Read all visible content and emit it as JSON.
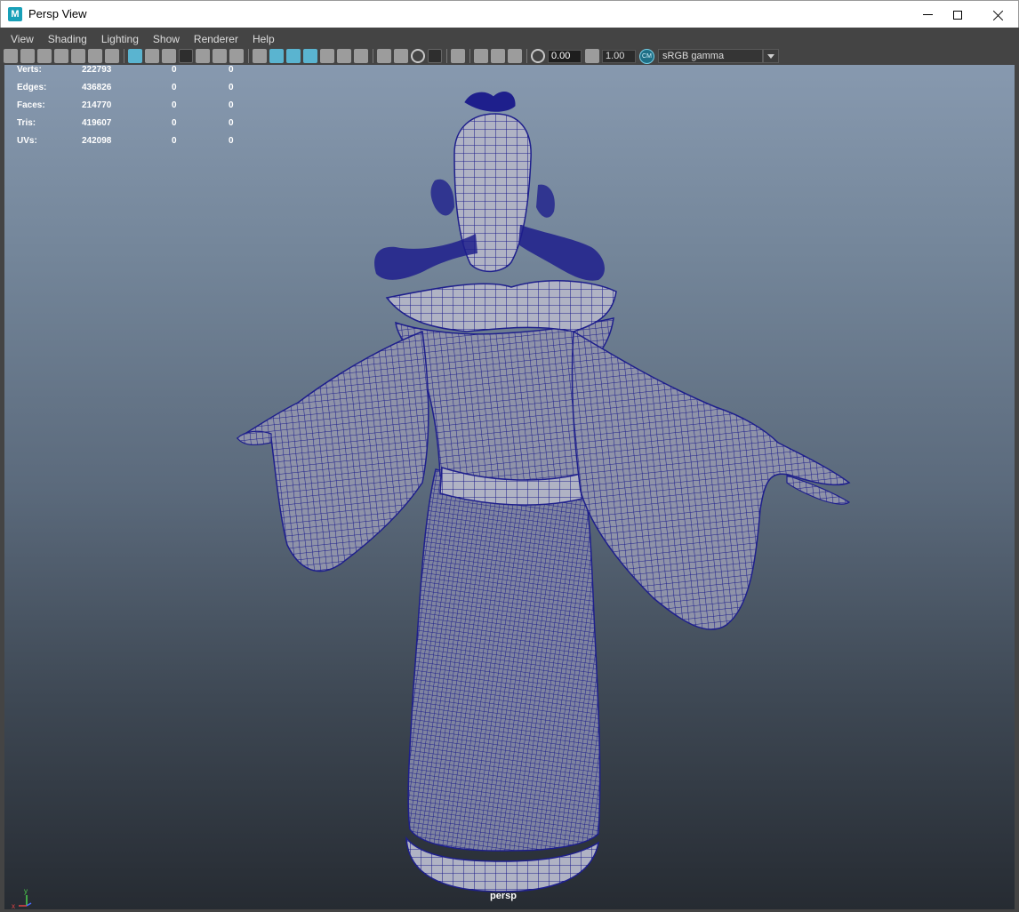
{
  "window": {
    "app_icon_letter": "M",
    "title": "Persp View",
    "controls": [
      "minimize-icon",
      "maximize-icon",
      "close-icon"
    ]
  },
  "menubar": {
    "items": [
      "View",
      "Shading",
      "Lighting",
      "Show",
      "Renderer",
      "Help"
    ]
  },
  "toolbar": {
    "exposure_value": "0.00",
    "gamma_value": "1.00",
    "color_management_badge": "CM",
    "color_space": "sRGB gamma"
  },
  "hud": {
    "stats": [
      {
        "label": "Verts:",
        "value": "222793",
        "selected": "0",
        "components": "0"
      },
      {
        "label": "Edges:",
        "value": "436826",
        "selected": "0",
        "components": "0"
      },
      {
        "label": "Faces:",
        "value": "214770",
        "selected": "0",
        "components": "0"
      },
      {
        "label": "Tris:",
        "value": "419607",
        "selected": "0",
        "components": "0"
      },
      {
        "label": "UVs:",
        "value": "242098",
        "selected": "0",
        "components": "0"
      }
    ]
  },
  "viewport": {
    "camera_label": "persp",
    "axis_labels": {
      "x": "x",
      "y": "y",
      "z": "z"
    },
    "wire_color": "#1e1f8c",
    "surface_color": "#8f93a9"
  }
}
